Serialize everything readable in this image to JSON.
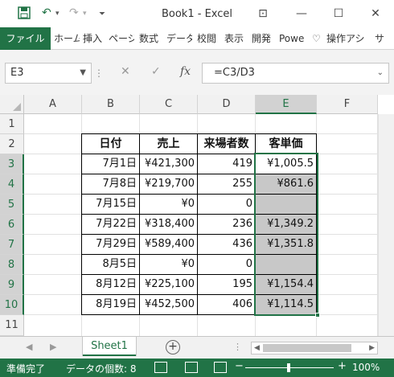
{
  "titlebar": {
    "title": "Book1 - Excel",
    "save_icon": "save-icon",
    "undo_icon": "undo-icon",
    "redo_icon": "redo-icon",
    "customize_icon": "customize-qat-icon",
    "ribbon_display_icon": "ribbon-display-options-icon",
    "minimize_icon": "minimize-icon",
    "maximize_icon": "maximize-icon",
    "close_icon": "close-icon"
  },
  "ribbon": {
    "file_tab": "ファイル",
    "tabs": [
      "ホーム",
      "挿入",
      "ページ",
      "数式",
      "データ",
      "校閲",
      "表示",
      "開発",
      "Powe",
      "操作アシ",
      "サ"
    ]
  },
  "formula_bar": {
    "name_box": "E3",
    "formula": "=C3/D3",
    "fx_label": "fx"
  },
  "columns": [
    "A",
    "B",
    "C",
    "D",
    "E",
    "F"
  ],
  "selected_column": "E",
  "rows": [
    "1",
    "2",
    "3",
    "4",
    "5",
    "6",
    "7",
    "8",
    "9",
    "10",
    "11"
  ],
  "table": {
    "headers": [
      "日付",
      "売上",
      "来場者数",
      "客単価"
    ],
    "data": [
      [
        "7月1日",
        "¥421,300",
        "419",
        "¥1,005.5"
      ],
      [
        "7月8日",
        "¥219,700",
        "255",
        "¥861.6"
      ],
      [
        "7月15日",
        "¥0",
        "0",
        ""
      ],
      [
        "7月22日",
        "¥318,400",
        "236",
        "¥1,349.2"
      ],
      [
        "7月29日",
        "¥589,400",
        "436",
        "¥1,351.8"
      ],
      [
        "8月5日",
        "¥0",
        "0",
        ""
      ],
      [
        "8月12日",
        "¥225,100",
        "195",
        "¥1,154.4"
      ],
      [
        "8月19日",
        "¥452,500",
        "406",
        "¥1,114.5"
      ]
    ]
  },
  "sheets": {
    "active": "Sheet1"
  },
  "status": {
    "mode": "準備完了",
    "count": "データの個数: 8",
    "zoom": "100%"
  }
}
